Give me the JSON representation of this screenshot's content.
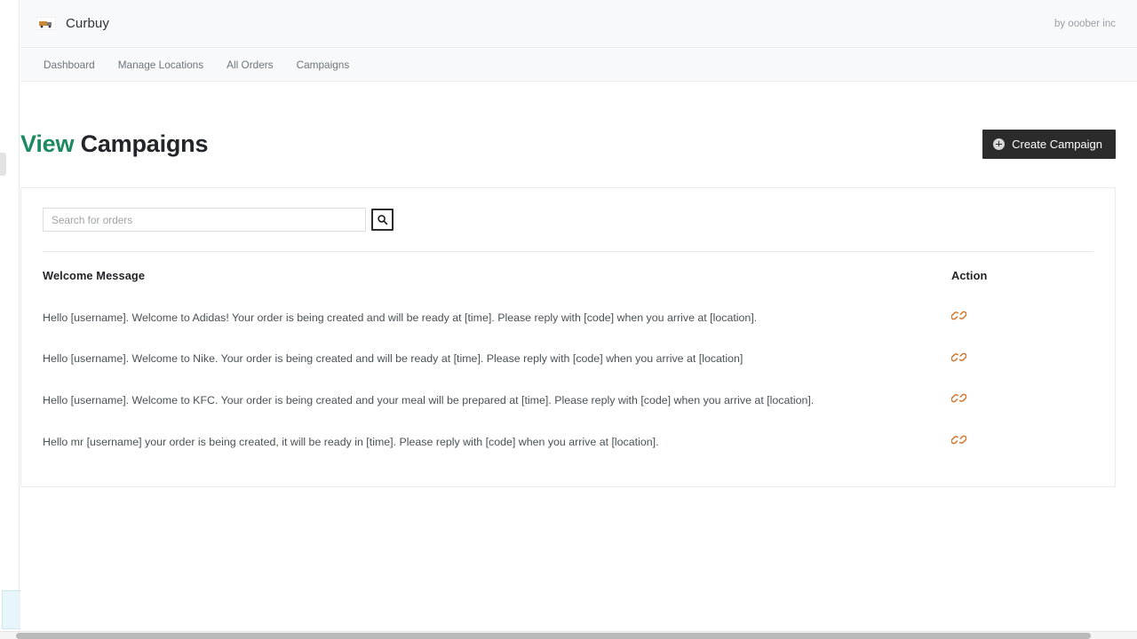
{
  "brand": {
    "logo_icon": "curbuy-logo-icon",
    "name": "Curbuy",
    "credit": "by ooober inc"
  },
  "nav": {
    "items": [
      {
        "label": "Dashboard"
      },
      {
        "label": "Manage Locations"
      },
      {
        "label": "All Orders"
      },
      {
        "label": "Campaigns"
      }
    ]
  },
  "header": {
    "title_accent": "View",
    "title_plain": "Campaigns",
    "accent_color": "#1e8a5f",
    "create_button": {
      "label": "Create Campaign",
      "icon": "plus-circle-icon",
      "background": "#2b2b2b",
      "text_color": "#ffffff"
    }
  },
  "search": {
    "placeholder": "Search for orders",
    "value": "",
    "button_icon": "search-icon"
  },
  "table": {
    "columns": [
      {
        "key": "message",
        "label": "Welcome Message"
      },
      {
        "key": "action",
        "label": "Action"
      }
    ],
    "action_icon": "link-chain-icon",
    "action_icon_color": "#d2732a",
    "rows": [
      {
        "message": "Hello [username]. Welcome to Adidas! Your order is being created and will be ready at [time]. Please reply with [code] when you arrive at [location]."
      },
      {
        "message": "Hello [username]. Welcome to Nike. Your order is being created and will be ready at [time]. Please reply with [code] when you arrive at [location]"
      },
      {
        "message": "Hello [username]. Welcome to KFC. Your order is being created and your meal will be prepared at [time]. Please reply with [code] when you arrive at [location]."
      },
      {
        "message": "Hello mr [username] your order is being created, it will be ready in [time]. Please reply with [code] when you arrive at [location]."
      }
    ]
  }
}
